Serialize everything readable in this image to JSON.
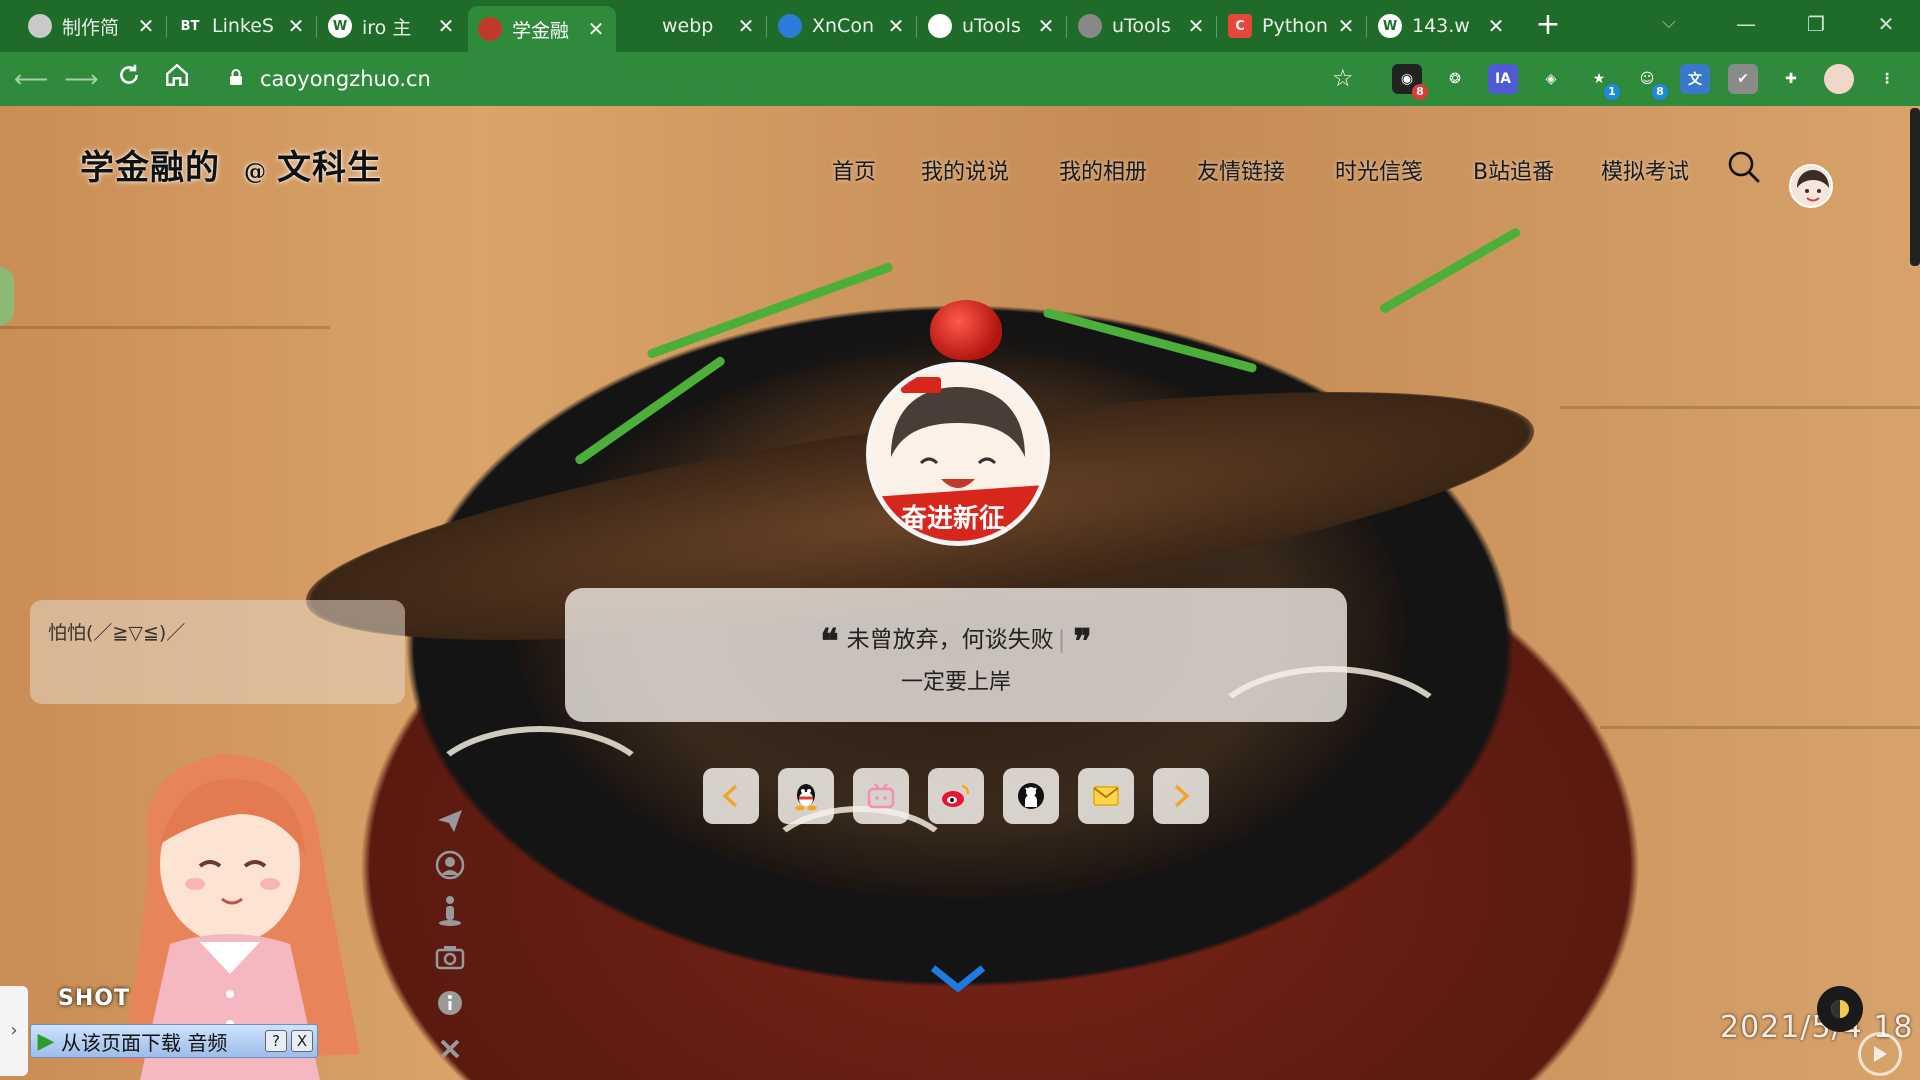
{
  "browser": {
    "tabs": [
      {
        "title": "制作简",
        "icon": "site-icon",
        "color": "#c9c9c9"
      },
      {
        "title": "LinkeS",
        "icon": "bt-icon",
        "color": "#1f6b2a"
      },
      {
        "title": "iro 主",
        "icon": "wordpress-icon",
        "color": "#ffffff"
      },
      {
        "title": "学金融",
        "icon": "avatar-favicon",
        "color": "#c0392b",
        "active": true
      },
      {
        "title": "webp",
        "icon": "webp-icon",
        "color": "#1f6b2a"
      },
      {
        "title": "XnCon",
        "icon": "xnconvert-icon",
        "color": "#2b7bd9"
      },
      {
        "title": "uTools",
        "icon": "utools-icon",
        "color": "#ffffff"
      },
      {
        "title": "uTools",
        "icon": "utools-icon",
        "color": "#888888"
      },
      {
        "title": "Python",
        "icon": "csdn-icon",
        "color": "#e8453c"
      },
      {
        "title": "143.w",
        "icon": "wordpress-icon",
        "color": "#ffffff"
      }
    ],
    "close_glyph": "✕",
    "new_tab_glyph": "+",
    "url": "caoyongzhuo.cn",
    "extensions": [
      {
        "name": "ext-badge-icon",
        "badge": "8",
        "badge_color": "#e53935"
      },
      {
        "name": "ext-shield-icon",
        "badge": ""
      },
      {
        "name": "ext-ia-icon",
        "label": "IA",
        "badge": ""
      },
      {
        "name": "ext-globe-icon",
        "badge": ""
      },
      {
        "name": "ext-star-icon",
        "badge": "1",
        "badge_color": "#1e88e5"
      },
      {
        "name": "ext-cat-icon",
        "badge": "8",
        "badge_color": "#1e88e5"
      },
      {
        "name": "ext-translate-icon",
        "badge": ""
      },
      {
        "name": "ext-check-icon",
        "badge": ""
      },
      {
        "name": "extensions-puzzle-icon",
        "badge": ""
      },
      {
        "name": "profile-avatar-icon",
        "badge": ""
      },
      {
        "name": "menu-dots-icon",
        "badge": ""
      }
    ]
  },
  "site": {
    "logo_text": "学金融的",
    "logo_at": "@",
    "logo_suffix": "文科生",
    "nav": [
      "首页",
      "我的说说",
      "我的相册",
      "友情链接",
      "时光信笺",
      "B站追番",
      "模拟考试"
    ],
    "bubble_text": "怕怕(／≧▽≦)／",
    "quote_text": "未曾放弃，何谈失败",
    "quote_sub": "一定要上岸",
    "quote_open": "❝",
    "quote_close": "❞",
    "social_buttons": [
      "prev-arrow",
      "qq-icon",
      "bilibili-icon",
      "weibo-icon",
      "github-icon",
      "mail-icon",
      "next-arrow"
    ],
    "side_tools": [
      "send-icon",
      "user-icon",
      "person-icon",
      "camera-icon",
      "info-icon",
      "close-icon"
    ],
    "shot_label": "SHOT",
    "download_bar_text": "从该页面下载 音频",
    "download_help": "?",
    "download_close": "X",
    "left_tab_glyph": "›",
    "clock": "2021/5/4 18"
  }
}
